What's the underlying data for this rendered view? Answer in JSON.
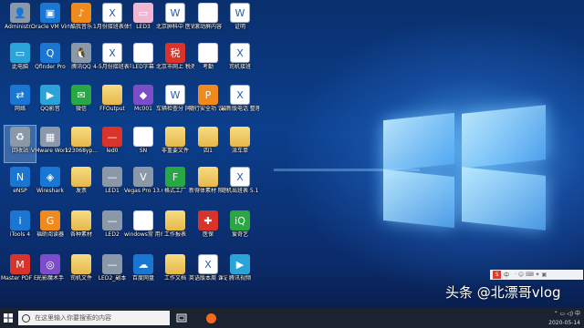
{
  "desktop": {
    "icons": [
      {
        "label": "Administr...",
        "kind": "user",
        "col": 0,
        "row": 0
      },
      {
        "label": "Oracle VM VirtualBox",
        "kind": "virtualbox",
        "col": 1,
        "row": 0
      },
      {
        "label": "酷我音乐",
        "kind": "music",
        "col": 2,
        "row": 0
      },
      {
        "label": "1月份接班表体信息科",
        "kind": "excel",
        "col": 3,
        "row": 0
      },
      {
        "label": "LED3",
        "kind": "image",
        "col": 4,
        "row": 0
      },
      {
        "label": "北京肿科中 医肾病医...",
        "kind": "word",
        "col": 5,
        "row": 0
      },
      {
        "label": "滚动屏内容",
        "kind": "doc",
        "col": 6,
        "row": 0
      },
      {
        "label": "证明",
        "kind": "word",
        "col": 7,
        "row": 0
      },
      {
        "label": "此电脑",
        "kind": "pc",
        "col": 0,
        "row": 1
      },
      {
        "label": "Qfinder Pro",
        "kind": "qfinder",
        "col": 1,
        "row": 1
      },
      {
        "label": "腾讯QQ",
        "kind": "qq",
        "col": 2,
        "row": 1
      },
      {
        "label": "4-5月份接班表可机班",
        "kind": "excel",
        "col": 3,
        "row": 1
      },
      {
        "label": "LED字幕",
        "kind": "doc",
        "col": 4,
        "row": 1
      },
      {
        "label": "北京市网上 税务局(...",
        "kind": "tax",
        "col": 5,
        "row": 1
      },
      {
        "label": "考勤",
        "kind": "doc",
        "col": 6,
        "row": 1
      },
      {
        "label": "司机接班",
        "kind": "excel",
        "col": 7,
        "row": 1
      },
      {
        "label": "网络",
        "kind": "network",
        "col": 0,
        "row": 2
      },
      {
        "label": "QQ影音",
        "kind": "qqplayer",
        "col": 1,
        "row": 2
      },
      {
        "label": "微信",
        "kind": "wechat",
        "col": 2,
        "row": 2
      },
      {
        "label": "FFOutput",
        "kind": "folder",
        "col": 3,
        "row": 2
      },
      {
        "label": "Mc001",
        "kind": "media",
        "col": 4,
        "row": 2
      },
      {
        "label": "车辆检查分 同(配带...",
        "kind": "word",
        "col": 5,
        "row": 2
      },
      {
        "label": "随行安全功 议说明",
        "kind": "ppt",
        "col": 6,
        "row": 2
      },
      {
        "label": "最新版电话 整理202...",
        "kind": "excel",
        "col": 7,
        "row": 2
      },
      {
        "label": "回收站",
        "kind": "recycle",
        "col": 0,
        "row": 3,
        "selected": true
      },
      {
        "label": "VMware Workstati...",
        "kind": "vmware",
        "col": 1,
        "row": 3
      },
      {
        "label": "123068yp...",
        "kind": "folder",
        "col": 2,
        "row": 3
      },
      {
        "label": "led0",
        "kind": "led",
        "col": 3,
        "row": 3
      },
      {
        "label": "SN",
        "kind": "doc",
        "col": 4,
        "row": 3
      },
      {
        "label": "非重要文件",
        "kind": "folder",
        "col": 5,
        "row": 3
      },
      {
        "label": "四1",
        "kind": "folder",
        "col": 6,
        "row": 3
      },
      {
        "label": "派车单",
        "kind": "folder",
        "col": 7,
        "row": 3
      },
      {
        "label": "eNSP",
        "kind": "ensp",
        "col": 0,
        "row": 4
      },
      {
        "label": "Wireshark",
        "kind": "wireshark",
        "col": 1,
        "row": 4
      },
      {
        "label": "发票",
        "kind": "folder",
        "col": 2,
        "row": 4
      },
      {
        "label": "LED1",
        "kind": "ledbar",
        "col": 3,
        "row": 4
      },
      {
        "label": "Vegas Pro 13.0 (64-bit)",
        "kind": "vegas",
        "col": 4,
        "row": 4
      },
      {
        "label": "格式工厂",
        "kind": "format",
        "col": 5,
        "row": 4
      },
      {
        "label": "新得体素材 照片库",
        "kind": "folder",
        "col": 6,
        "row": 4
      },
      {
        "label": "司机出班表 5.11",
        "kind": "excel",
        "col": 7,
        "row": 4
      },
      {
        "label": "iTools 4",
        "kind": "itools",
        "col": 0,
        "row": 5
      },
      {
        "label": "福昕阅读器",
        "kind": "foxit",
        "col": 1,
        "row": 5
      },
      {
        "label": "各种素材",
        "kind": "folder",
        "col": 2,
        "row": 5
      },
      {
        "label": "LED2",
        "kind": "ledbar",
        "col": 3,
        "row": 5
      },
      {
        "label": "windows常 用命令",
        "kind": "doc",
        "col": 4,
        "row": 5
      },
      {
        "label": "工作报表",
        "kind": "folder",
        "col": 5,
        "row": 5
      },
      {
        "label": "医保",
        "kind": "medical",
        "col": 6,
        "row": 5
      },
      {
        "label": "爱奇艺",
        "kind": "iqiyi",
        "col": 7,
        "row": 5
      },
      {
        "label": "Master PDF Editor 5",
        "kind": "pdf",
        "col": 0,
        "row": 6
      },
      {
        "label": "光影魔术手",
        "kind": "camera",
        "col": 1,
        "row": 6
      },
      {
        "label": "司机文件",
        "kind": "folder",
        "col": 2,
        "row": 6
      },
      {
        "label": "LED2_副本",
        "kind": "ledbar",
        "col": 3,
        "row": 6
      },
      {
        "label": "百度网盘",
        "kind": "baidu",
        "col": 4,
        "row": 6
      },
      {
        "label": "工作文档",
        "kind": "folder",
        "col": 5,
        "row": 6
      },
      {
        "label": "英语版本周 课记录表",
        "kind": "excel",
        "col": 6,
        "row": 6
      },
      {
        "label": "腾讯视频",
        "kind": "tencentvideo",
        "col": 7,
        "row": 6
      }
    ]
  },
  "taskbar": {
    "search_placeholder": "在这里输入你要搜索的内容",
    "date": "2020-05-14",
    "time": ""
  },
  "ime_bar": {
    "label": "中"
  },
  "watermark": {
    "text": "头条 @北漂哥vlog"
  }
}
